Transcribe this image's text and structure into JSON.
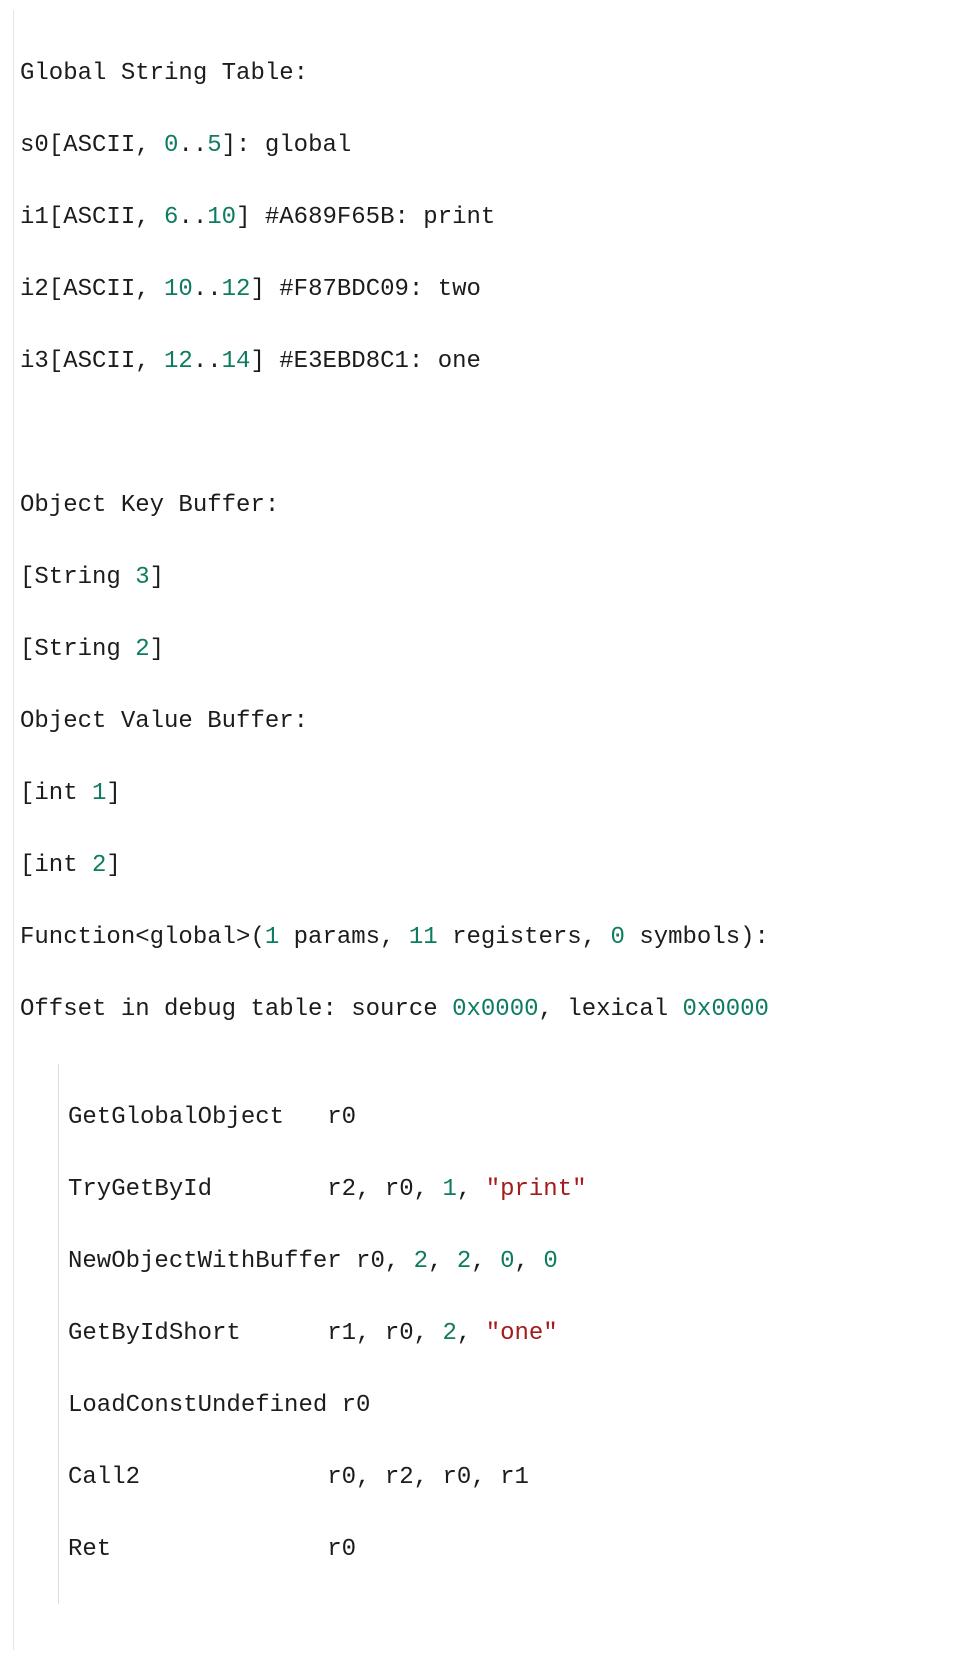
{
  "gst": {
    "heading": "Global String Table:",
    "s0_label": "s0[ASCII, ",
    "s0_r0": "0",
    "s0_mid": "..",
    "s0_r1": "5",
    "s0_rest": "]: global",
    "i1_label": "i1[ASCII, ",
    "i1_r0": "6",
    "i1_mid": "..",
    "i1_r1": "10",
    "i1_rest": "] #A689F65B: print",
    "i2_label": "i2[ASCII, ",
    "i2_r0": "10",
    "i2_mid": "..",
    "i2_r1": "12",
    "i2_rest": "] #F87BDC09: two",
    "i3_label": "i3[ASCII, ",
    "i3_r0": "12",
    "i3_mid": "..",
    "i3_r1": "14",
    "i3_rest": "] #E3EBD8C1: one"
  },
  "okb": {
    "heading": "Object Key Buffer:",
    "l1_a": "[String ",
    "l1_n": "3",
    "l1_b": "]",
    "l2_a": "[String ",
    "l2_n": "2",
    "l2_b": "]"
  },
  "ovb": {
    "heading": "Object Value Buffer:",
    "l1_a": "[int ",
    "l1_n": "1",
    "l1_b": "]",
    "l2_a": "[int ",
    "l2_n": "2",
    "l2_b": "]"
  },
  "fn": {
    "sig_a": "Function<global>(",
    "sig_p": "1",
    "sig_b": " params, ",
    "sig_r": "11",
    "sig_c": " registers, ",
    "sig_s": "0",
    "sig_d": " symbols):",
    "off_a": "Offset in debug table: source ",
    "off_s": "0x0000",
    "off_b": ", lexical ",
    "off_l": "0x0000"
  },
  "op1": {
    "a": "GetGlobalObject   r0"
  },
  "op2": {
    "a": "TryGetById        r2, r0, ",
    "n": "1",
    "b": ", ",
    "s": "\"print\""
  },
  "op3": {
    "a": "NewObjectWithBuffer r0, ",
    "n1": "2",
    "c1": ", ",
    "n2": "2",
    "c2": ", ",
    "n3": "0",
    "c3": ", ",
    "n4": "0"
  },
  "op4": {
    "a": "GetByIdShort      r1, r0, ",
    "n": "2",
    "b": ", ",
    "s": "\"one\""
  },
  "op5": {
    "a": "LoadConstUndefined r0"
  },
  "op6": {
    "a": "Call2             r0, r2, r0, r1"
  },
  "op7": {
    "a": "Ret               r0"
  }
}
